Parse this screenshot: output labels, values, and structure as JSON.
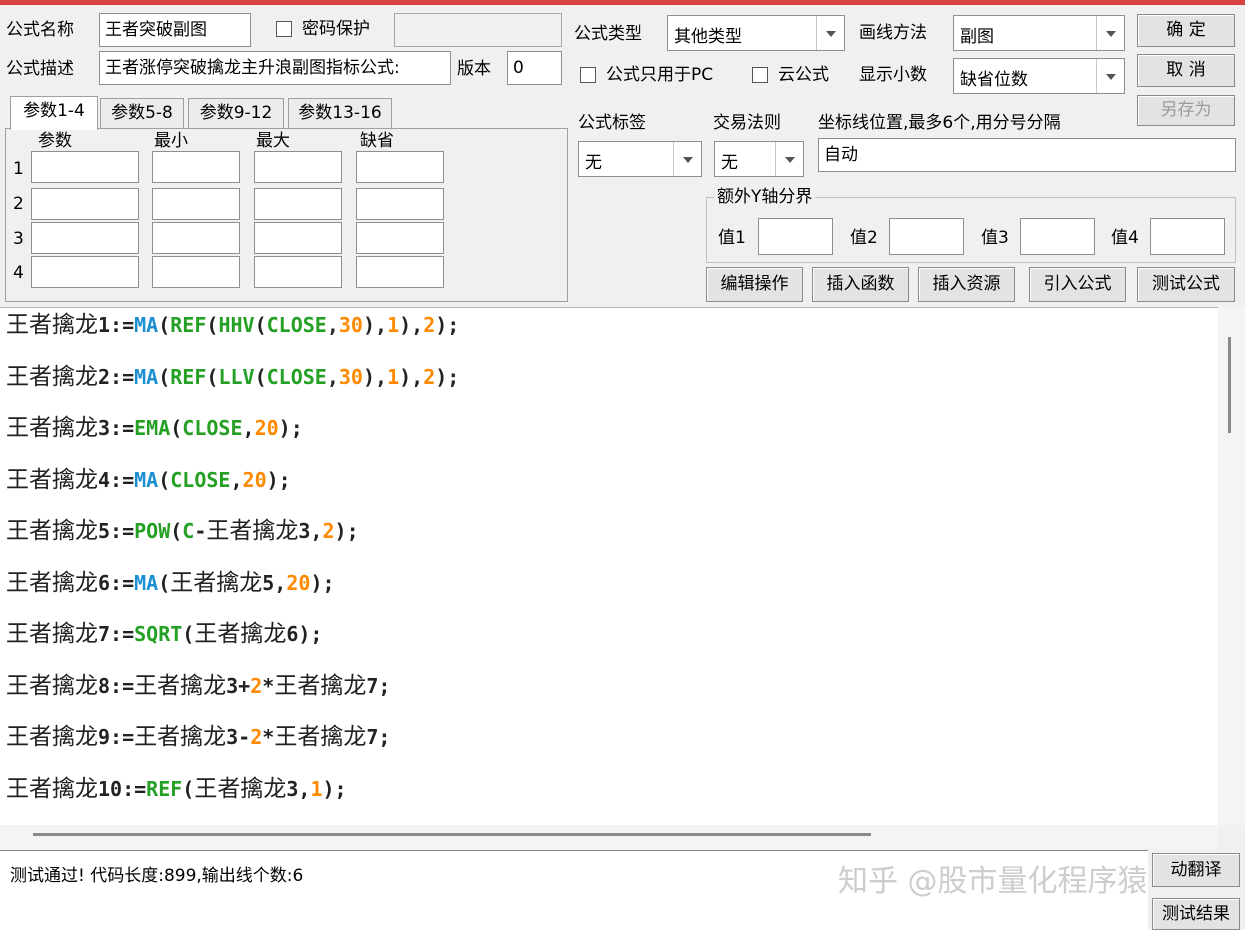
{
  "top": {
    "name_label": "公式名称",
    "name_value": "王者突破副图",
    "password_label": "密码保护",
    "desc_label": "公式描述",
    "desc_value": "王者涨停突破擒龙主升浪副图指标公式:",
    "version_label": "版本",
    "version_value": "0",
    "type_label": "公式类型",
    "type_value": "其他类型",
    "draw_label": "画线方法",
    "draw_value": "副图",
    "pc_only_label": "公式只用于PC",
    "cloud_label": "云公式",
    "decimals_label": "显示小数",
    "decimals_value": "缺省位数",
    "ok_button": "确  定",
    "cancel_button": "取  消",
    "saveas_button": "另存为"
  },
  "params": {
    "tabs": [
      "参数1-4",
      "参数5-8",
      "参数9-12",
      "参数13-16"
    ],
    "headers": [
      "参数",
      "最小",
      "最大",
      "缺省"
    ],
    "rows": [
      "1",
      "2",
      "3",
      "4"
    ]
  },
  "settings": {
    "tag_label": "公式标签",
    "tag_value": "无",
    "rule_label": "交易法则",
    "rule_value": "无",
    "axis_label": "坐标线位置,最多6个,用分号分隔",
    "axis_value": "自动",
    "yaxis_group": "额外Y轴分界",
    "val_labels": [
      "值1",
      "值2",
      "值3",
      "值4"
    ]
  },
  "actions": {
    "edit": "编辑操作",
    "insert_func": "插入函数",
    "insert_res": "插入资源",
    "import": "引入公式",
    "test": "测试公式"
  },
  "code": [
    [
      [
        "王者擒龙",
        "cn"
      ],
      [
        "1:=",
        ""
      ],
      [
        "MA",
        "kb"
      ],
      [
        "(",
        ""
      ],
      [
        "REF",
        "kg"
      ],
      [
        "(",
        ""
      ],
      [
        "HHV",
        "kg"
      ],
      [
        "(",
        ""
      ],
      [
        "CLOSE",
        "kg"
      ],
      [
        ",",
        ""
      ],
      [
        "30",
        "kn"
      ],
      [
        "),",
        ""
      ],
      [
        "1",
        "kn"
      ],
      [
        "),",
        ""
      ],
      [
        "2",
        "kn"
      ],
      [
        ");",
        ""
      ]
    ],
    [
      [
        "王者擒龙",
        "cn"
      ],
      [
        "2:=",
        ""
      ],
      [
        "MA",
        "kb"
      ],
      [
        "(",
        ""
      ],
      [
        "REF",
        "kg"
      ],
      [
        "(",
        ""
      ],
      [
        "LLV",
        "kg"
      ],
      [
        "(",
        ""
      ],
      [
        "CLOSE",
        "kg"
      ],
      [
        ",",
        ""
      ],
      [
        "30",
        "kn"
      ],
      [
        "),",
        ""
      ],
      [
        "1",
        "kn"
      ],
      [
        "),",
        ""
      ],
      [
        "2",
        "kn"
      ],
      [
        ");",
        ""
      ]
    ],
    [
      [
        "王者擒龙",
        "cn"
      ],
      [
        "3:=",
        ""
      ],
      [
        "EMA",
        "kg"
      ],
      [
        "(",
        ""
      ],
      [
        "CLOSE",
        "kg"
      ],
      [
        ",",
        ""
      ],
      [
        "20",
        "kn"
      ],
      [
        ");",
        ""
      ]
    ],
    [
      [
        "王者擒龙",
        "cn"
      ],
      [
        "4:=",
        ""
      ],
      [
        "MA",
        "kb"
      ],
      [
        "(",
        ""
      ],
      [
        "CLOSE",
        "kg"
      ],
      [
        ",",
        ""
      ],
      [
        "20",
        "kn"
      ],
      [
        ");",
        ""
      ]
    ],
    [
      [
        "王者擒龙",
        "cn"
      ],
      [
        "5:=",
        ""
      ],
      [
        "POW",
        "kg"
      ],
      [
        "(",
        ""
      ],
      [
        "C",
        "kg"
      ],
      [
        "-",
        ""
      ],
      [
        "王者擒龙",
        "cn"
      ],
      [
        "3,",
        ""
      ],
      [
        "2",
        "kn"
      ],
      [
        ");",
        ""
      ]
    ],
    [
      [
        "王者擒龙",
        "cn"
      ],
      [
        "6:=",
        ""
      ],
      [
        "MA",
        "kb"
      ],
      [
        "(",
        ""
      ],
      [
        "王者擒龙",
        "cn"
      ],
      [
        "5,",
        ""
      ],
      [
        "20",
        "kn"
      ],
      [
        ");",
        ""
      ]
    ],
    [
      [
        "王者擒龙",
        "cn"
      ],
      [
        "7:=",
        ""
      ],
      [
        "SQRT",
        "kg"
      ],
      [
        "(",
        ""
      ],
      [
        "王者擒龙",
        "cn"
      ],
      [
        "6);",
        ""
      ]
    ],
    [
      [
        "王者擒龙",
        "cn"
      ],
      [
        "8:=",
        ""
      ],
      [
        "王者擒龙",
        "cn"
      ],
      [
        "3+",
        ""
      ],
      [
        "2",
        "kn"
      ],
      [
        "*",
        ""
      ],
      [
        "王者擒龙",
        "cn"
      ],
      [
        "7;",
        ""
      ]
    ],
    [
      [
        "王者擒龙",
        "cn"
      ],
      [
        "9:=",
        ""
      ],
      [
        "王者擒龙",
        "cn"
      ],
      [
        "3-",
        ""
      ],
      [
        "2",
        "kn"
      ],
      [
        "*",
        ""
      ],
      [
        "王者擒龙",
        "cn"
      ],
      [
        "7;",
        ""
      ]
    ],
    [
      [
        "王者擒龙",
        "cn"
      ],
      [
        "10:=",
        ""
      ],
      [
        "REF",
        "kg"
      ],
      [
        "(",
        ""
      ],
      [
        "王者擒龙",
        "cn"
      ],
      [
        "3,",
        ""
      ],
      [
        "1",
        "kn"
      ],
      [
        ");",
        ""
      ]
    ]
  ],
  "output": {
    "message": "测试通过! 代码长度:899,输出线个数:6",
    "translate_button": "动翻译",
    "result_button": "测试结果"
  },
  "watermark": "知乎 @股市量化程序猿"
}
